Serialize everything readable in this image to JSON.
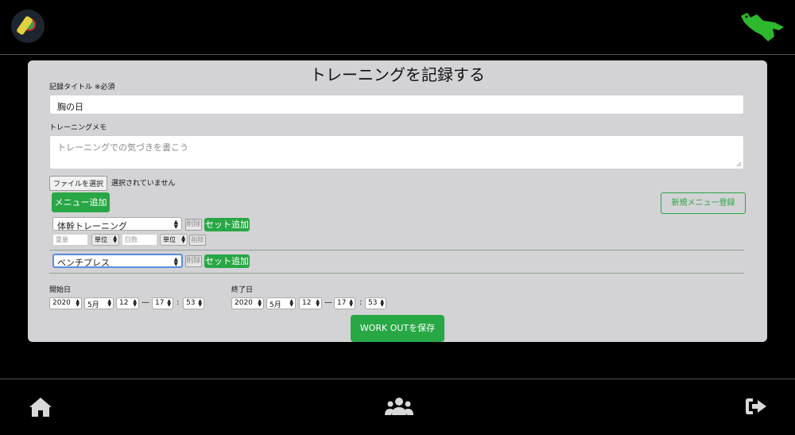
{
  "header": {
    "avatar_icon": "avatar-icon",
    "logo_icon": "crocodile-logo-icon",
    "logo_color": "#2db82d"
  },
  "page": {
    "title": "トレーニングを記録する"
  },
  "form": {
    "record_title_label": "記録タイトル ",
    "required_mark": "※必須",
    "record_title_value": "胸の日",
    "memo_label": "トレーニングメモ",
    "memo_placeholder": "トレーニングでの気づきを書こう",
    "file_button": "ファイルを選択",
    "file_status": "選択されていません",
    "add_menu_button": "メニュー追加",
    "register_menu_button": "新規メニュー登録",
    "menus": [
      {
        "name": "体幹トレーニング",
        "delete_label": "削除",
        "add_set_label": "セット追加",
        "sets": [
          {
            "weight_placeholder": "重量",
            "unit1": "単位",
            "reps_placeholder": "回数",
            "unit2": "単位",
            "delete_label": "削除"
          }
        ]
      },
      {
        "name": "ベンチプレス",
        "delete_label": "削除",
        "add_set_label": "セット追加"
      }
    ],
    "start_label": "開始日",
    "end_label": "終了日",
    "start": {
      "year": "2020",
      "month": "5月",
      "day": "12",
      "dash": "—",
      "hour": "17",
      "colon": ":",
      "minute": "53"
    },
    "end": {
      "year": "2020",
      "month": "5月",
      "day": "12",
      "dash": "—",
      "hour": "17",
      "colon": ":",
      "minute": "53"
    },
    "save_button": "WORK OUTを保存"
  },
  "nav": {
    "home_icon": "home-icon",
    "users_icon": "users-icon",
    "logout_icon": "sign-out-icon"
  },
  "colors": {
    "accent": "#28a745",
    "focus": "#5b8be5",
    "card": "#d3d2d5"
  }
}
